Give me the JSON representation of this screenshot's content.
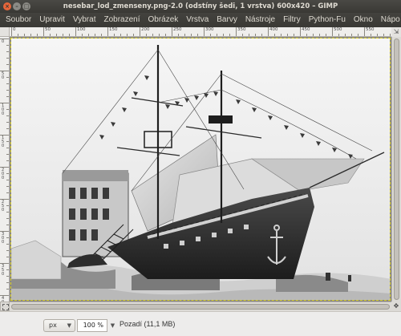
{
  "window": {
    "title": "nesebar_lod_zmenseny.png-2.0 (odstíny šedi, 1 vrstva) 600x420 – GIMP"
  },
  "menu": [
    "Soubor",
    "Upravit",
    "Vybrat",
    "Zobrazení",
    "Obrázek",
    "Vrstva",
    "Barvy",
    "Nástroje",
    "Filtry",
    "Python-Fu",
    "Okno",
    "Nápo"
  ],
  "ruler": {
    "h_labels": [
      "0",
      "50",
      "100",
      "150",
      "200",
      "250",
      "300",
      "350",
      "400",
      "450",
      "500",
      "550"
    ],
    "v_labels": [
      "0",
      "50",
      "100",
      "150",
      "200",
      "250",
      "300",
      "350",
      "400"
    ]
  },
  "statusbar": {
    "unit": "px",
    "zoom": "100 %",
    "layer_info": "Pozadí (11,1 MB)"
  },
  "icons": {
    "close": "close-icon",
    "minimize": "minimize-icon",
    "maximize": "maximize-icon",
    "quick_mask": "quick-mask-icon",
    "navigate": "navigate-icon",
    "zoom_dropdown": "chevron-down-icon"
  },
  "colors": {
    "title_bar": "#3c3b37",
    "selection_marching_ants": "#d8cf2a",
    "close_button": "#e9663a"
  }
}
